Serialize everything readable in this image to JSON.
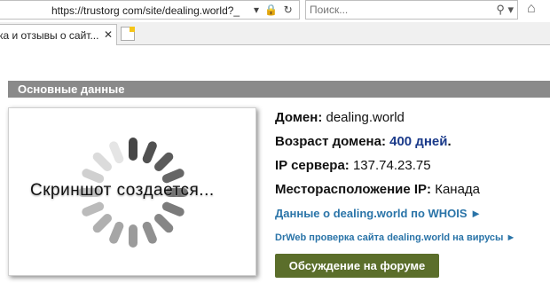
{
  "browser": {
    "url": "https://trustorg com/site/dealing.world?_",
    "search_placeholder": "Поиск...",
    "tab_title": "ка и отзывы о сайт..."
  },
  "section": {
    "title": "Основные данные"
  },
  "thumbnail": {
    "caption": "Скриншот создается..."
  },
  "info": {
    "domain_label": "Домен:",
    "domain_value": "dealing.world",
    "age_label": "Возраст домена:",
    "age_value": "400 дней",
    "age_suffix": ".",
    "ip_label": "IP сервера:",
    "ip_value": "137.74.23.75",
    "location_label": "Месторасположение IP:",
    "location_value": "Канада"
  },
  "links": {
    "whois": "Данные о dealing.world по WHOIS ►",
    "drweb": "DrWeb проверка сайта dealing.world на вирусы ►"
  },
  "forum_button": "Обсуждение на форуме",
  "colors": {
    "section_header": "#8a8a8a",
    "link": "#2a74a8",
    "age_value": "#1a3a8a",
    "forum_button": "#5b6e2b"
  }
}
